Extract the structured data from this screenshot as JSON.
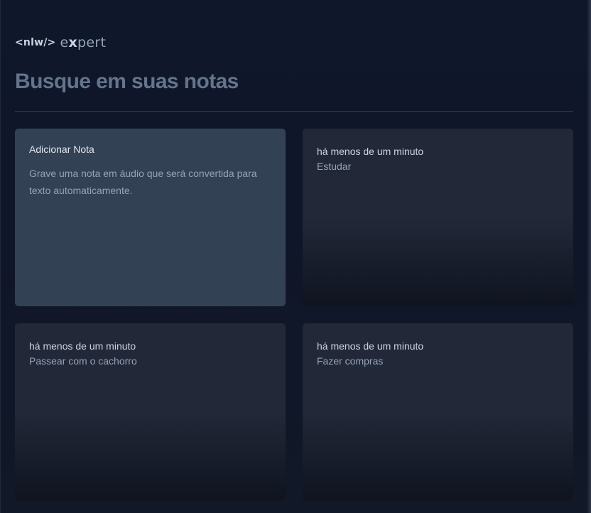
{
  "logo": {
    "nlw": "<nlw/>",
    "expert_prefix": "e",
    "expert_x": "x",
    "expert_suffix": "pert"
  },
  "search": {
    "placeholder": "Busque em suas notas",
    "value": ""
  },
  "add_note": {
    "title": "Adicionar Nota",
    "description": "Grave uma nota em áudio que será convertida para texto automaticamente."
  },
  "notes": [
    {
      "date": "há menos de um minuto",
      "content": "Estudar"
    },
    {
      "date": "há menos de um minuto",
      "content": "Passear com o cachorro"
    },
    {
      "date": "há menos de um minuto",
      "content": "Fazer compras"
    }
  ]
}
